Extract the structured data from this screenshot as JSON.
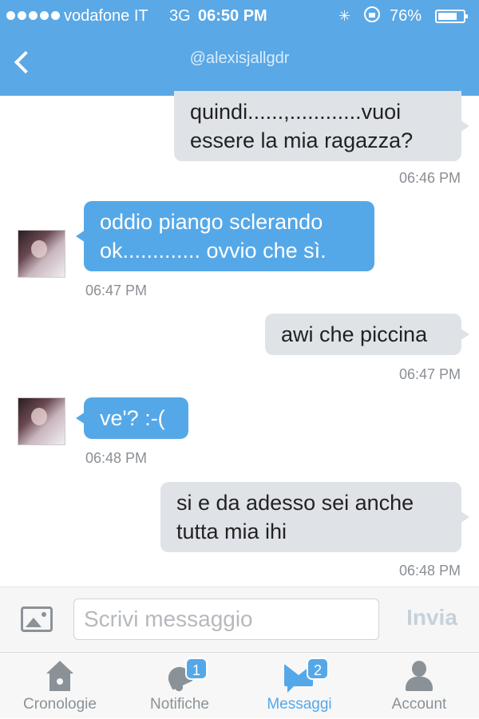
{
  "status_bar": {
    "carrier": "vodafone IT",
    "network": "3G",
    "time": "06:50 PM",
    "battery": "76%",
    "battery_level": 0.76
  },
  "header": {
    "handle": "@alexisjallgdr",
    "back_icon": "chevron-left-icon"
  },
  "messages": [
    {
      "direction": "out",
      "text_lines": [
        "quindi......,............vuoi",
        "essere la mia ragazza?"
      ],
      "time": "06:46 PM"
    },
    {
      "direction": "in",
      "text_lines": [
        "oddio piango sclerando",
        "ok............. ovvio che sì."
      ],
      "time": "06:47 PM"
    },
    {
      "direction": "out",
      "text_lines": [
        "awi che piccina"
      ],
      "time": "06:47 PM"
    },
    {
      "direction": "in",
      "text_lines": [
        "ve'? :-("
      ],
      "time": "06:48 PM"
    },
    {
      "direction": "out",
      "text_lines": [
        "si e da adesso sei anche",
        "tutta mia ihi"
      ],
      "time": "06:48 PM"
    }
  ],
  "composer": {
    "photo_icon": "image-icon",
    "placeholder": "Scrivi messaggio",
    "value": "",
    "send_label": "Invia"
  },
  "tabs": [
    {
      "label": "Cronologie",
      "icon": "home-icon",
      "badge": "",
      "active": false
    },
    {
      "label": "Notifiche",
      "icon": "bell-icon",
      "badge": "1",
      "active": false
    },
    {
      "label": "Messaggi",
      "icon": "envelope-icon",
      "badge": "2",
      "active": true
    },
    {
      "label": "Account",
      "icon": "person-icon",
      "badge": "",
      "active": false
    }
  ],
  "colors": {
    "accent": "#55a8e8",
    "header": "#5aa8e6",
    "outgoing_bubble": "#dfe3e8"
  }
}
